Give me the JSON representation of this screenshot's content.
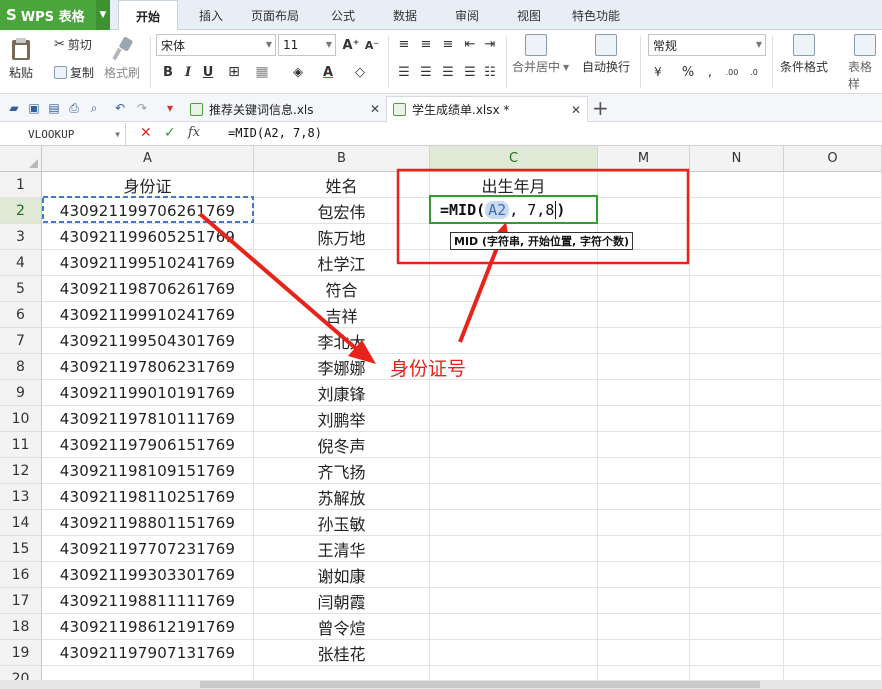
{
  "app": {
    "name": "WPS 表格",
    "logo_glyph": "S"
  },
  "menu_tabs": [
    {
      "label": "开始",
      "active": true
    },
    {
      "label": "插入"
    },
    {
      "label": "页面布局"
    },
    {
      "label": "公式"
    },
    {
      "label": "数据"
    },
    {
      "label": "审阅"
    },
    {
      "label": "视图"
    },
    {
      "label": "特色功能"
    }
  ],
  "ribbon": {
    "paste": "粘贴",
    "cut": "剪切",
    "copy": "复制",
    "format_painter": "格式刷",
    "font_name": "宋体",
    "font_size": "11",
    "merge_center": "合并居中",
    "wrap_text": "自动换行",
    "number_format": "常规",
    "conditional_format": "条件格式",
    "table_style": "表格样"
  },
  "documents": [
    {
      "name": "推荐关键词信息.xls",
      "active": false
    },
    {
      "name": "学生成绩单.xlsx *",
      "active": true
    }
  ],
  "formula_bar": {
    "name_box": "VLOOKUP",
    "formula": "=MID(A2, 7,8)"
  },
  "columns": [
    "A",
    "B",
    "C",
    "M",
    "N",
    "O"
  ],
  "headers": {
    "a": "身份证",
    "b": "姓名",
    "c": "出生年月"
  },
  "rows": [
    {
      "n": "1"
    },
    {
      "n": "2",
      "id": "430921199706261769",
      "name": "包宏伟"
    },
    {
      "n": "3",
      "id": "430921199605251769",
      "name": "陈万地"
    },
    {
      "n": "4",
      "id": "430921199510241769",
      "name": "杜学江"
    },
    {
      "n": "5",
      "id": "430921198706261769",
      "name": "符合"
    },
    {
      "n": "6",
      "id": "430921199910241769",
      "name": "吉祥"
    },
    {
      "n": "7",
      "id": "430921199504301769",
      "name": "李北大"
    },
    {
      "n": "8",
      "id": "430921197806231769",
      "name": "李娜娜"
    },
    {
      "n": "9",
      "id": "430921199010191769",
      "name": "刘康锋"
    },
    {
      "n": "10",
      "id": "430921197810111769",
      "name": "刘鹏举"
    },
    {
      "n": "11",
      "id": "430921197906151769",
      "name": "倪冬声"
    },
    {
      "n": "12",
      "id": "430921198109151769",
      "name": "齐飞扬"
    },
    {
      "n": "13",
      "id": "430921198110251769",
      "name": "苏解放"
    },
    {
      "n": "14",
      "id": "430921198801151769",
      "name": "孙玉敏"
    },
    {
      "n": "15",
      "id": "430921197707231769",
      "name": "王清华"
    },
    {
      "n": "16",
      "id": "430921199303301769",
      "name": "谢如康"
    },
    {
      "n": "17",
      "id": "430921198811111769",
      "name": "闫朝霞"
    },
    {
      "n": "18",
      "id": "430921198612191769",
      "name": "曾令煊"
    },
    {
      "n": "19",
      "id": "430921197907131769",
      "name": "张桂花"
    },
    {
      "n": "20"
    }
  ],
  "editing_cell": {
    "prefix": "=MID(",
    "ref": "A2",
    "suffix": ", 7,8",
    "close": ")"
  },
  "tooltip": "MID (字符串, 开始位置, 字符个数)",
  "annotation": {
    "label": "身份证号",
    "color": "#e8231a"
  },
  "colors": {
    "wps_green": "#4aa53b",
    "selection_border": "#3f7bd0",
    "edit_border": "#2e9e2e"
  }
}
